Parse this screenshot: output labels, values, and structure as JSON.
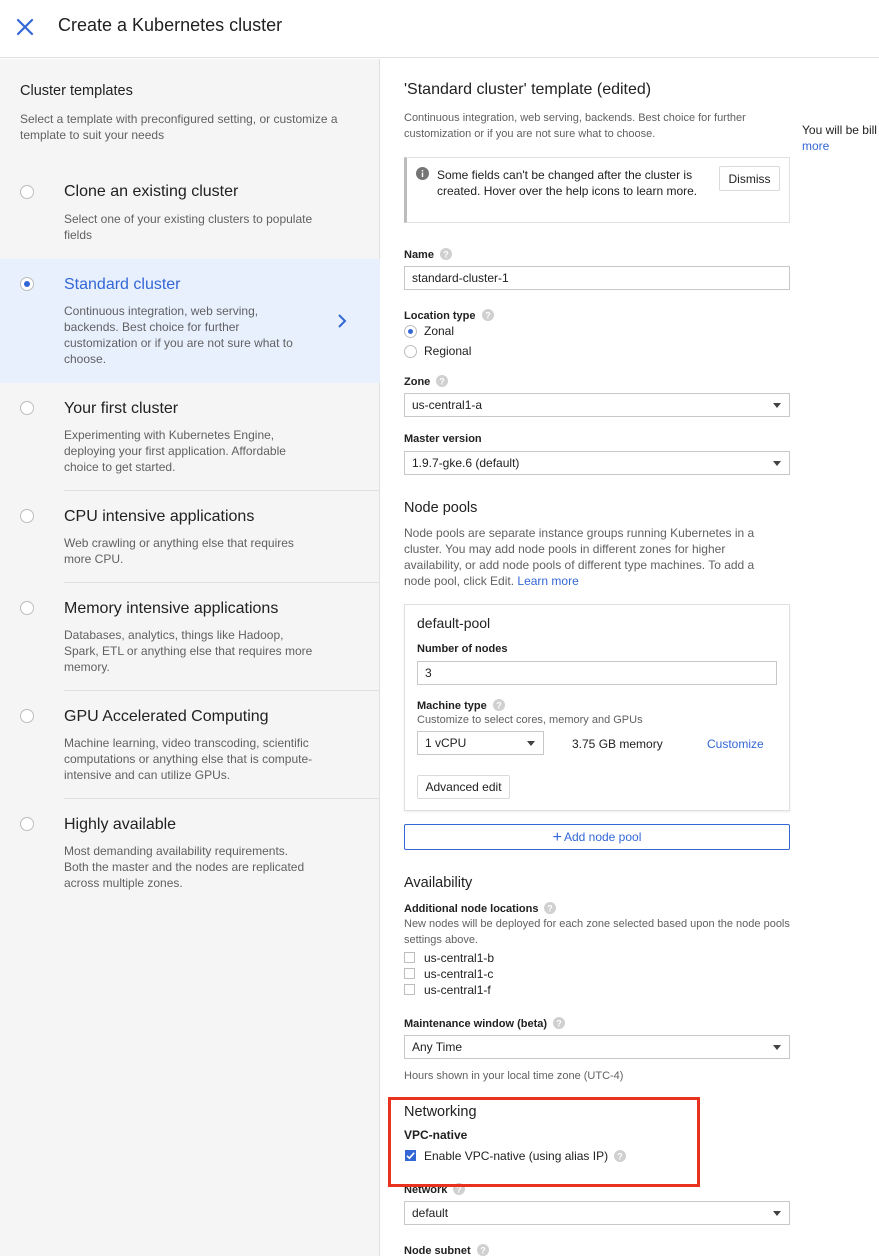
{
  "header": {
    "title": "Create a Kubernetes cluster"
  },
  "templates": {
    "title": "Cluster templates",
    "description": "Select a template with preconfigured setting, or customize a template to suit your needs",
    "items": [
      {
        "name": "Clone an existing cluster",
        "description": "Select one of your existing clusters to populate fields",
        "selected": false
      },
      {
        "name": "Standard cluster",
        "description": "Continuous integration, web serving, backends. Best choice for further customization or if you are not sure what to choose.",
        "selected": true
      },
      {
        "name": "Your first cluster",
        "description": "Experimenting with Kubernetes Engine, deploying your first application. Affordable choice to get started.",
        "selected": false
      },
      {
        "name": "CPU intensive applications",
        "description": "Web crawling or anything else that requires more CPU.",
        "selected": false
      },
      {
        "name": "Memory intensive applications",
        "description": "Databases, analytics, things like Hadoop, Spark, ETL or anything else that requires more memory.",
        "selected": false
      },
      {
        "name": "GPU Accelerated Computing",
        "description": "Machine learning, video transcoding, scientific computations or anything else that is compute-intensive and can utilize GPUs.",
        "selected": false
      },
      {
        "name": "Highly available",
        "description": "Most demanding availability requirements. Both the master and the nodes are replicated across multiple zones.",
        "selected": false
      }
    ]
  },
  "form": {
    "title": "'Standard cluster' template (edited)",
    "description": "Continuous integration, web serving, backends. Best choice for further customization or if you are not sure what to choose.",
    "billing_text": "You will be bill",
    "billing_more": "more",
    "notice": {
      "text": "Some fields can't be changed after the cluster is created. Hover over the help icons to learn more.",
      "dismiss_label": "Dismiss"
    },
    "name": {
      "label": "Name",
      "value": "standard-cluster-1"
    },
    "location_type": {
      "label": "Location type",
      "options": [
        "Zonal",
        "Regional"
      ],
      "selected": "Zonal"
    },
    "zone": {
      "label": "Zone",
      "value": "us-central1-a"
    },
    "master_version": {
      "label": "Master version",
      "value": "1.9.7-gke.6 (default)"
    },
    "node_pools": {
      "title": "Node pools",
      "description": "Node pools are separate instance groups running Kubernetes in a cluster. You may add node pools in different zones for higher availability, or add node pools of different type machines. To add a node pool, click Edit.",
      "learn_more": "Learn more",
      "pool": {
        "name": "default-pool",
        "nodes_label": "Number of nodes",
        "nodes_value": "3",
        "machine_type_label": "Machine type",
        "machine_type_hint": "Customize to select cores, memory and GPUs",
        "machine_type_value": "1 vCPU",
        "memory": "3.75 GB memory",
        "customize_label": "Customize",
        "advanced_edit_label": "Advanced edit"
      },
      "add_pool_label": "Add node pool"
    },
    "availability": {
      "title": "Availability",
      "locations_label": "Additional node locations",
      "locations_desc": "New nodes will be deployed for each zone selected based upon the node pools settings above.",
      "locations": [
        {
          "name": "us-central1-b",
          "checked": false
        },
        {
          "name": "us-central1-c",
          "checked": false
        },
        {
          "name": "us-central1-f",
          "checked": false
        }
      ]
    },
    "maintenance": {
      "label": "Maintenance window (beta)",
      "value": "Any Time",
      "hint": "Hours shown in your local time zone (UTC-4)"
    },
    "networking": {
      "title": "Networking",
      "vpc_label": "VPC-native",
      "vpc_checkbox_label": "Enable VPC-native (using alias IP)",
      "vpc_checked": true,
      "network_label": "Network",
      "network_value": "default",
      "subnet_label": "Node subnet"
    }
  },
  "colors": {
    "accent": "#3367d6",
    "highlight": "#e8321e",
    "selected_bg": "#e8f0fe"
  }
}
